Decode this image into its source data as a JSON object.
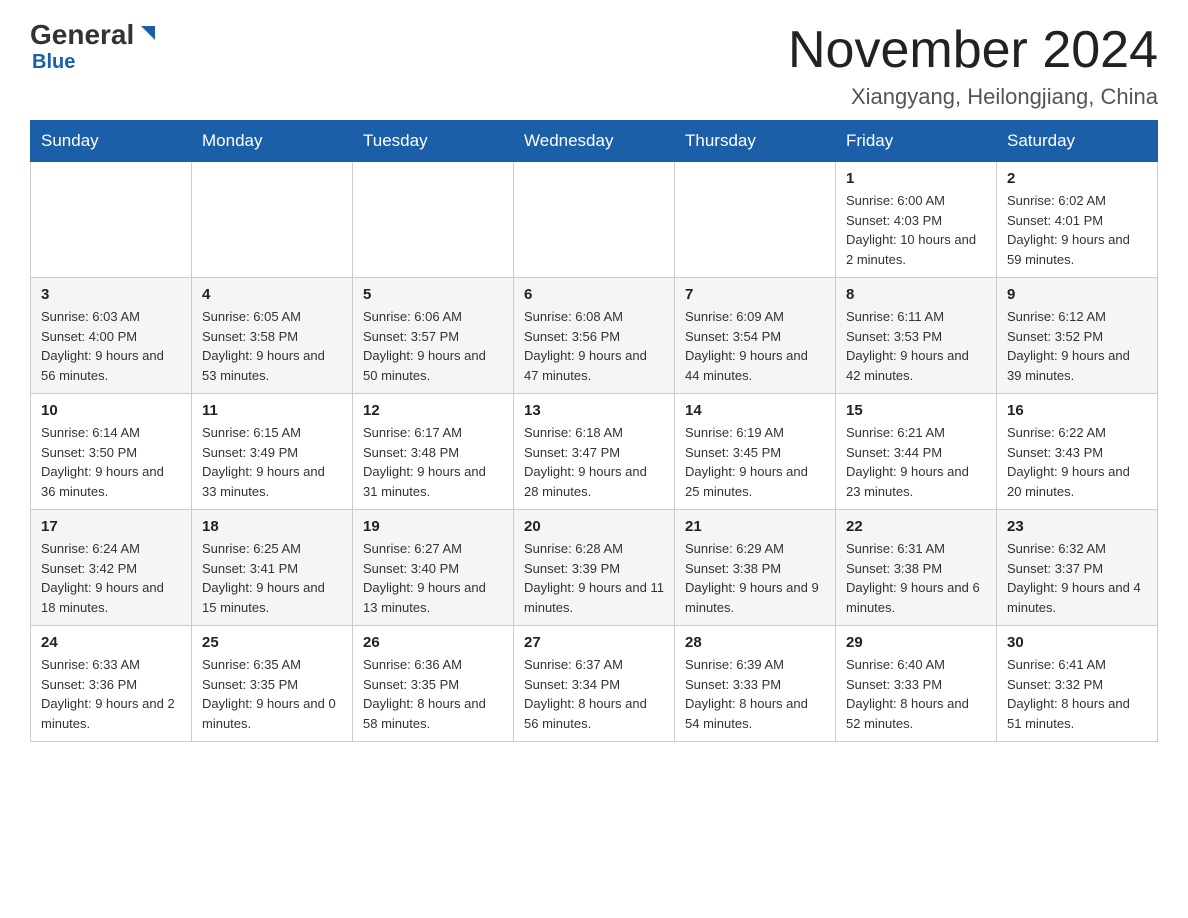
{
  "header": {
    "logo_main": "General",
    "logo_sub": "Blue",
    "month_title": "November 2024",
    "location": "Xiangyang, Heilongjiang, China"
  },
  "weekdays": [
    "Sunday",
    "Monday",
    "Tuesday",
    "Wednesday",
    "Thursday",
    "Friday",
    "Saturday"
  ],
  "weeks": [
    [
      {
        "day": "",
        "info": ""
      },
      {
        "day": "",
        "info": ""
      },
      {
        "day": "",
        "info": ""
      },
      {
        "day": "",
        "info": ""
      },
      {
        "day": "",
        "info": ""
      },
      {
        "day": "1",
        "info": "Sunrise: 6:00 AM\nSunset: 4:03 PM\nDaylight: 10 hours and 2 minutes."
      },
      {
        "day": "2",
        "info": "Sunrise: 6:02 AM\nSunset: 4:01 PM\nDaylight: 9 hours and 59 minutes."
      }
    ],
    [
      {
        "day": "3",
        "info": "Sunrise: 6:03 AM\nSunset: 4:00 PM\nDaylight: 9 hours and 56 minutes."
      },
      {
        "day": "4",
        "info": "Sunrise: 6:05 AM\nSunset: 3:58 PM\nDaylight: 9 hours and 53 minutes."
      },
      {
        "day": "5",
        "info": "Sunrise: 6:06 AM\nSunset: 3:57 PM\nDaylight: 9 hours and 50 minutes."
      },
      {
        "day": "6",
        "info": "Sunrise: 6:08 AM\nSunset: 3:56 PM\nDaylight: 9 hours and 47 minutes."
      },
      {
        "day": "7",
        "info": "Sunrise: 6:09 AM\nSunset: 3:54 PM\nDaylight: 9 hours and 44 minutes."
      },
      {
        "day": "8",
        "info": "Sunrise: 6:11 AM\nSunset: 3:53 PM\nDaylight: 9 hours and 42 minutes."
      },
      {
        "day": "9",
        "info": "Sunrise: 6:12 AM\nSunset: 3:52 PM\nDaylight: 9 hours and 39 minutes."
      }
    ],
    [
      {
        "day": "10",
        "info": "Sunrise: 6:14 AM\nSunset: 3:50 PM\nDaylight: 9 hours and 36 minutes."
      },
      {
        "day": "11",
        "info": "Sunrise: 6:15 AM\nSunset: 3:49 PM\nDaylight: 9 hours and 33 minutes."
      },
      {
        "day": "12",
        "info": "Sunrise: 6:17 AM\nSunset: 3:48 PM\nDaylight: 9 hours and 31 minutes."
      },
      {
        "day": "13",
        "info": "Sunrise: 6:18 AM\nSunset: 3:47 PM\nDaylight: 9 hours and 28 minutes."
      },
      {
        "day": "14",
        "info": "Sunrise: 6:19 AM\nSunset: 3:45 PM\nDaylight: 9 hours and 25 minutes."
      },
      {
        "day": "15",
        "info": "Sunrise: 6:21 AM\nSunset: 3:44 PM\nDaylight: 9 hours and 23 minutes."
      },
      {
        "day": "16",
        "info": "Sunrise: 6:22 AM\nSunset: 3:43 PM\nDaylight: 9 hours and 20 minutes."
      }
    ],
    [
      {
        "day": "17",
        "info": "Sunrise: 6:24 AM\nSunset: 3:42 PM\nDaylight: 9 hours and 18 minutes."
      },
      {
        "day": "18",
        "info": "Sunrise: 6:25 AM\nSunset: 3:41 PM\nDaylight: 9 hours and 15 minutes."
      },
      {
        "day": "19",
        "info": "Sunrise: 6:27 AM\nSunset: 3:40 PM\nDaylight: 9 hours and 13 minutes."
      },
      {
        "day": "20",
        "info": "Sunrise: 6:28 AM\nSunset: 3:39 PM\nDaylight: 9 hours and 11 minutes."
      },
      {
        "day": "21",
        "info": "Sunrise: 6:29 AM\nSunset: 3:38 PM\nDaylight: 9 hours and 9 minutes."
      },
      {
        "day": "22",
        "info": "Sunrise: 6:31 AM\nSunset: 3:38 PM\nDaylight: 9 hours and 6 minutes."
      },
      {
        "day": "23",
        "info": "Sunrise: 6:32 AM\nSunset: 3:37 PM\nDaylight: 9 hours and 4 minutes."
      }
    ],
    [
      {
        "day": "24",
        "info": "Sunrise: 6:33 AM\nSunset: 3:36 PM\nDaylight: 9 hours and 2 minutes."
      },
      {
        "day": "25",
        "info": "Sunrise: 6:35 AM\nSunset: 3:35 PM\nDaylight: 9 hours and 0 minutes."
      },
      {
        "day": "26",
        "info": "Sunrise: 6:36 AM\nSunset: 3:35 PM\nDaylight: 8 hours and 58 minutes."
      },
      {
        "day": "27",
        "info": "Sunrise: 6:37 AM\nSunset: 3:34 PM\nDaylight: 8 hours and 56 minutes."
      },
      {
        "day": "28",
        "info": "Sunrise: 6:39 AM\nSunset: 3:33 PM\nDaylight: 8 hours and 54 minutes."
      },
      {
        "day": "29",
        "info": "Sunrise: 6:40 AM\nSunset: 3:33 PM\nDaylight: 8 hours and 52 minutes."
      },
      {
        "day": "30",
        "info": "Sunrise: 6:41 AM\nSunset: 3:32 PM\nDaylight: 8 hours and 51 minutes."
      }
    ]
  ]
}
